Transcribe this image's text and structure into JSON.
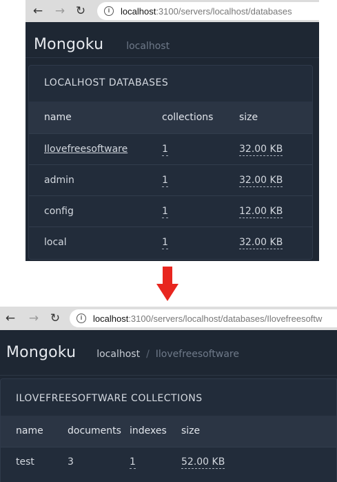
{
  "screenshot1": {
    "browser": {
      "url_host": "localhost",
      "url_path": ":3100/servers/localhost/databases"
    },
    "app": {
      "brand": "Mongoku",
      "breadcrumb": "localhost"
    },
    "panel": {
      "title": "LOCALHOST DATABASES",
      "columns": [
        "name",
        "collections",
        "size"
      ],
      "rows": [
        {
          "name": "Ilovefreesoftware",
          "collections": "1",
          "size": "32.00 KB"
        },
        {
          "name": "admin",
          "collections": "1",
          "size": "32.00 KB"
        },
        {
          "name": "config",
          "collections": "1",
          "size": "12.00 KB"
        },
        {
          "name": "local",
          "collections": "1",
          "size": "32.00 KB"
        }
      ]
    }
  },
  "arrow": {
    "icon": "down-arrow-icon",
    "color": "#e8261f"
  },
  "screenshot2": {
    "browser": {
      "url_host": "localhost",
      "url_path": ":3100/servers/localhost/databases/Ilovefreesoftw"
    },
    "app": {
      "brand": "Mongoku",
      "breadcrumb_server": "localhost",
      "breadcrumb_separator": "/",
      "breadcrumb_database": "Ilovefreesoftware"
    },
    "panel": {
      "title": "ILOVEFREESOFTWARE COLLECTIONS",
      "columns": [
        "name",
        "documents",
        "indexes",
        "size"
      ],
      "rows": [
        {
          "name": "test",
          "documents": "3",
          "indexes": "1",
          "size": "52.00 KB"
        }
      ]
    }
  }
}
